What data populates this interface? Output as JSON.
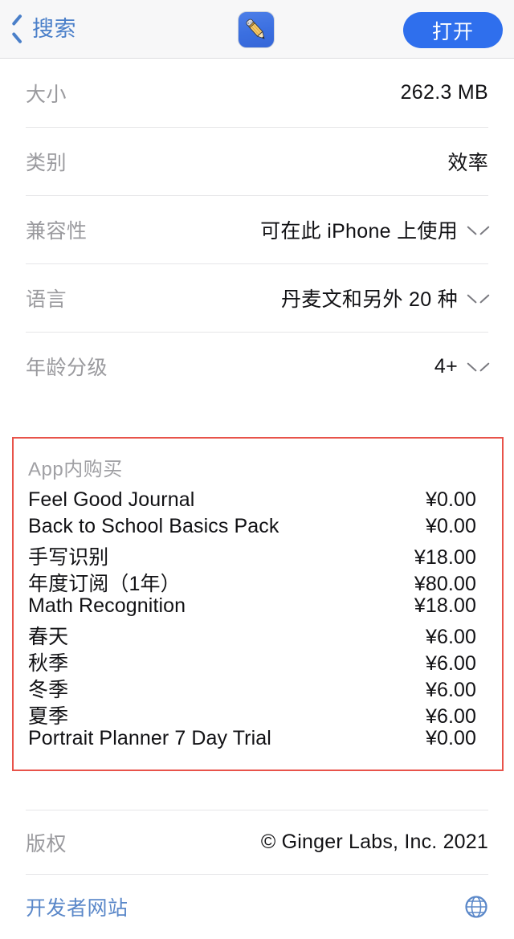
{
  "navbar": {
    "back_label": "搜索",
    "back_icon": "chevron-left-icon",
    "app_icon": "notability-pencil-app-icon",
    "open_button_label": "打开",
    "accent_color": "#2f6fed",
    "link_color": "#4a7fc9"
  },
  "info_rows": [
    {
      "label": "大小",
      "value": "262.3 MB",
      "chevron": false
    },
    {
      "label": "类别",
      "value": "效率",
      "chevron": false
    },
    {
      "label": "兼容性",
      "value": "可在此 iPhone 上使用",
      "chevron": true
    },
    {
      "label": "语言",
      "value": "丹麦文和另外 20 种",
      "chevron": true
    },
    {
      "label": "年龄分级",
      "value": "4+",
      "chevron": true
    }
  ],
  "in_app_purchases": {
    "title": "App内购买",
    "highlight_color": "#e8534a",
    "items": [
      {
        "name": "Feel Good Journal",
        "price": "¥0.00"
      },
      {
        "name": "Back to School Basics Pack",
        "price": "¥0.00"
      },
      {
        "name": "手写识别",
        "price": "¥18.00"
      },
      {
        "name": "年度订阅（1年）",
        "price": "¥80.00"
      },
      {
        "name": "Math Recognition",
        "price": "¥18.00"
      },
      {
        "name": "春天",
        "price": "¥6.00"
      },
      {
        "name": "秋季",
        "price": "¥6.00"
      },
      {
        "name": "冬季",
        "price": "¥6.00"
      },
      {
        "name": "夏季",
        "price": "¥6.00"
      },
      {
        "name": "Portrait Planner 7 Day Trial",
        "price": "¥0.00"
      }
    ]
  },
  "footer": {
    "copyright_label": "版权",
    "copyright_value": "© Ginger Labs, Inc. 2021",
    "developer_site_label": "开发者网站",
    "developer_site_icon": "globe-icon"
  }
}
